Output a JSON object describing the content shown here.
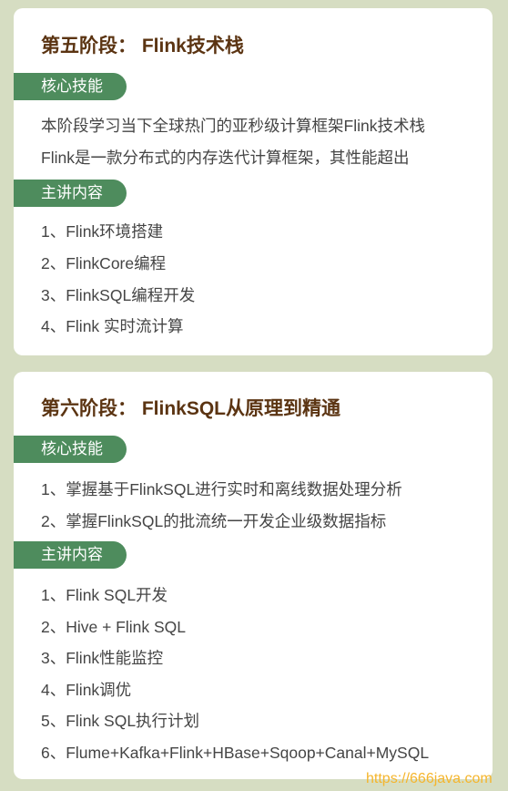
{
  "stage5": {
    "title": "第五阶段： Flink技术栈",
    "skills_label": "核心技能",
    "skills": [
      "本阶段学习当下全球热门的亚秒级计算框架Flink技术栈",
      "Flink是一款分布式的内存迭代计算框架，其性能超出"
    ],
    "content_label": "主讲内容",
    "content": [
      "1、Flink环境搭建",
      "2、FlinkCore编程",
      "3、FlinkSQL编程开发",
      "4、Flink 实时流计算"
    ]
  },
  "stage6": {
    "title": "第六阶段： FlinkSQL从原理到精通",
    "skills_label": "核心技能",
    "skills": [
      "1、掌握基于FlinkSQL进行实时和离线数据处理分析",
      "2、掌握FlinkSQL的批流统一开发企业级数据指标"
    ],
    "content_label": "主讲内容",
    "content": [
      "1、Flink SQL开发",
      "2、Hive + Flink SQL",
      "3、Flink性能监控",
      "4、Flink调优",
      "5、Flink SQL执行计划",
      "6、Flume+Kafka+Flink+HBase+Sqoop+Canal+MySQL"
    ]
  },
  "watermark": "https://666java.com"
}
